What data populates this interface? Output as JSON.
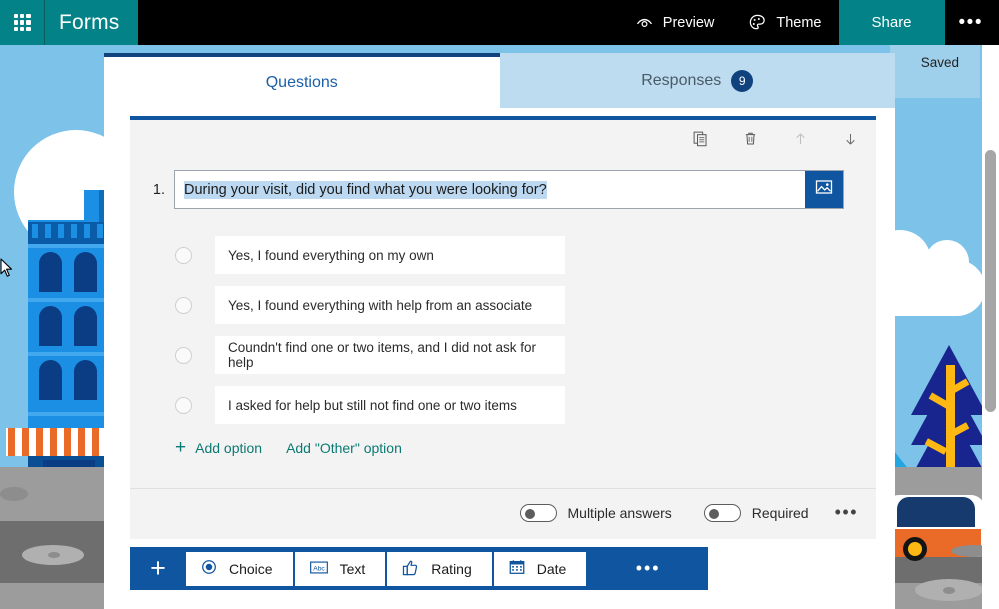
{
  "suite": {
    "waffle_icon": "app-launcher-waffle-icon",
    "brand": "Forms",
    "preview": {
      "label": "Preview",
      "icon": "eye-preview-icon"
    },
    "theme": {
      "label": "Theme",
      "icon": "palette-theme-icon"
    },
    "share": {
      "label": "Share"
    },
    "more": {
      "label": "•••",
      "icon": "more-ellipsis-icon"
    },
    "accent_teal": "#038387",
    "bar_background": "#000000"
  },
  "tabs": {
    "questions": {
      "label": "Questions",
      "active": true
    },
    "responses": {
      "label": "Responses",
      "count": "9",
      "active": false
    }
  },
  "status": {
    "saved": "Saved"
  },
  "question": {
    "number": "1.",
    "title": "During your visit, did you find what you were looking for?",
    "title_selected": true,
    "image_button_icon": "insert-image-icon",
    "tools": [
      {
        "name": "copy-question",
        "icon": "copy-icon",
        "glyph": "copy"
      },
      {
        "name": "delete-question",
        "icon": "trash-icon",
        "glyph": "trash"
      },
      {
        "name": "move-question-up",
        "icon": "arrow-up-icon",
        "glyph": "↑",
        "disabled": true
      },
      {
        "name": "move-question-down",
        "icon": "arrow-down-icon",
        "glyph": "↓",
        "disabled": false
      }
    ],
    "options": [
      "Yes, I found everything on my own",
      "Yes, I found everything with help from an associate",
      "Coundn't find one or two items, and I did not ask for help",
      "I asked for help but still not find one or two items"
    ],
    "add_option": "Add option",
    "add_other_option": "Add \"Other\" option",
    "multiple_answers": {
      "label": "Multiple answers",
      "on": false
    },
    "required": {
      "label": "Required",
      "on": false
    },
    "more_settings": "•••",
    "accent_navy": "#10559f",
    "link_teal": "#0b7a72"
  },
  "add_question_bar": {
    "plus": "+",
    "types": [
      {
        "label": "Choice",
        "icon": "radio-choice-icon"
      },
      {
        "label": "Text",
        "icon": "abc-text-icon"
      },
      {
        "label": "Rating",
        "icon": "thumbs-up-rating-icon"
      },
      {
        "label": "Date",
        "icon": "calendar-date-icon"
      }
    ],
    "more": "•••"
  }
}
